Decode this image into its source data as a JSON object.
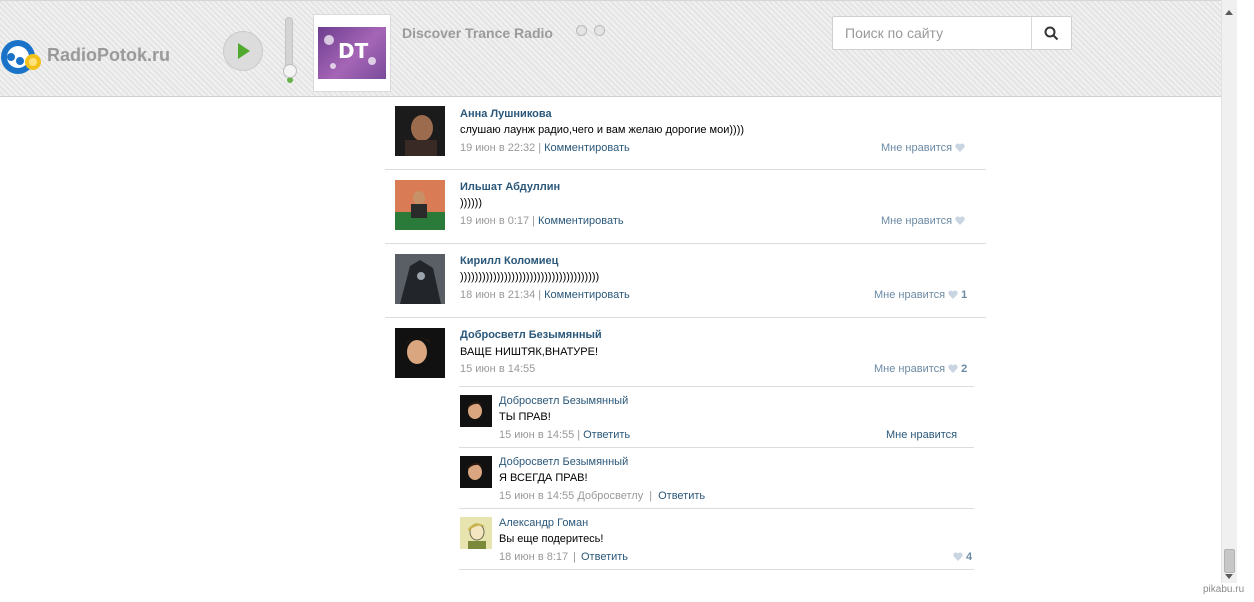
{
  "header": {
    "logo_text": "RadioPotok.ru",
    "station_name": "Discover Trance Radio",
    "station_logo_text": "DT",
    "search": {
      "placeholder": "Поиск по сайту"
    },
    "colors": {
      "accent_green": "#68b04a",
      "link": "#2b587a",
      "logo_blue": "#1a73c9",
      "logo_yellow": "#f2c21b"
    },
    "volume_level": 0.1
  },
  "comments": [
    {
      "author": "Анна Лушникова",
      "text": "слушаю лаунж радио,чего и вам желаю дорогие мои))))",
      "date": "19 июн в 22:32",
      "action": "Комментировать",
      "like_label": "Мне нравится",
      "like_count": ""
    },
    {
      "author": "Ильшат Абдуллин",
      "text": "))))))",
      "date": "19 июн в 0:17",
      "action": "Комментировать",
      "like_label": "Мне нравится",
      "like_count": ""
    },
    {
      "author": "Кирилл Коломиец",
      "text": "))))))))))))))))))))))))))))))))))))))",
      "date": "18 июн в 21:34",
      "action": "Комментировать",
      "like_label": "Мне нравится",
      "like_count": "1"
    },
    {
      "author": "Добросветл Безымянный",
      "text": "ВАЩЕ НИШТЯК,ВНАТУРЕ!",
      "date": "15 июн в 14:55",
      "action": "",
      "like_label": "Мне нравится",
      "like_count": "2"
    }
  ],
  "replies": [
    {
      "author": "Добросветл Безымянный",
      "text": "ТЫ ПРАВ!",
      "date": "15 июн в 14:55",
      "to": "",
      "action": "Ответить",
      "like_label": "Мне нравится",
      "like_count": ""
    },
    {
      "author": "Добросветл Безымянный",
      "text": "Я ВСЕГДА ПРАВ!",
      "date": "15 июн в 14:55",
      "to": "Добросветлу",
      "action": "Ответить",
      "like_label": "",
      "like_count": ""
    },
    {
      "author": "Александр Гоман",
      "text": "Вы еще подеритесь!",
      "date": "18 июн в 8:17",
      "to": "",
      "action": "Ответить",
      "like_label": "",
      "like_count": "4"
    }
  ],
  "watermark": "pikabu.ru"
}
